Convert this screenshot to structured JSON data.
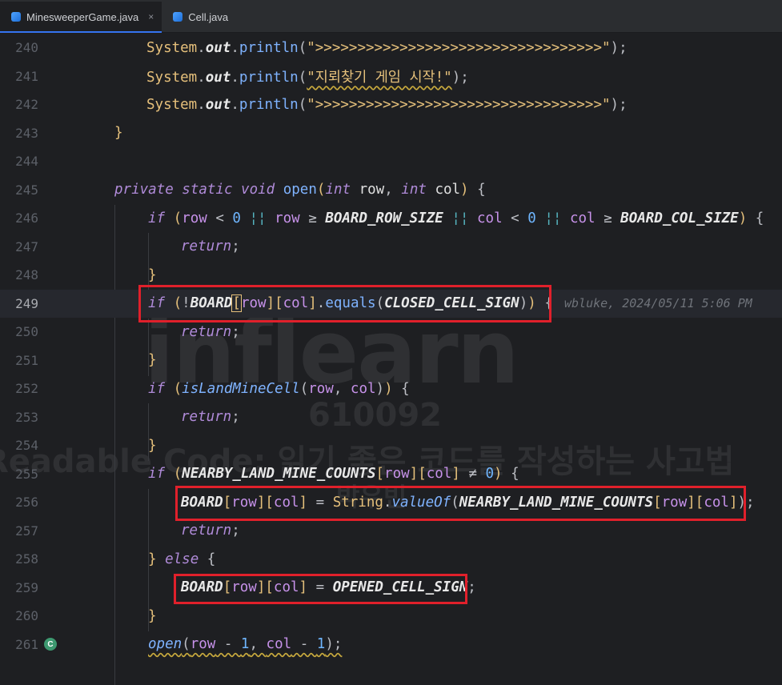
{
  "tabs": [
    {
      "label": "MinesweeperGame.java",
      "active": true,
      "close": "×"
    },
    {
      "label": "Cell.java",
      "active": false
    }
  ],
  "inlay_blame": "wbluke, 2024/05/11 5:06 PM",
  "watermark": {
    "brand": "inflearn",
    "id": "610092",
    "course": "Readable Code: 읽기 좋은 코드를 작성하는 사고법",
    "author": "박우빈"
  },
  "gutter_icon": "C",
  "lines": {
    "240": "240",
    "241": "241",
    "242": "242",
    "243": "243",
    "244": "244",
    "245": "245",
    "246": "246",
    "247": "247",
    "248": "248",
    "249": "249",
    "250": "250",
    "251": "251",
    "252": "252",
    "253": "253",
    "254": "254",
    "255": "255",
    "256": "256",
    "257": "257",
    "258": "258",
    "259": "259",
    "260": "260",
    "261": "261"
  },
  "code": {
    "system": "System",
    "out": "out",
    "println": "println",
    "str_arrows": "\">>>>>>>>>>>>>>>>>>>>>>>>>>>>>>>>>>\"",
    "str_start": "\"지뢰찾기 게임 시작!\"",
    "private_static_void": "private static void",
    "open": "open",
    "int": "int",
    "row": "row",
    "col": "col",
    "if": "if",
    "return": "return",
    "else": "else",
    "board": "BOARD",
    "board_row_size": "BOARD_ROW_SIZE",
    "board_col_size": "BOARD_COL_SIZE",
    "equals": "equals",
    "closed_cell_sign": "CLOSED_CELL_SIGN",
    "is_land_mine_cell": "isLandMineCell",
    "nearby": "NEARBY_LAND_MINE_COUNTS",
    "string": "String",
    "value_of": "valueOf",
    "opened_cell_sign": "OPENED_CELL_SIGN",
    "zero": "0",
    "one": "1"
  }
}
